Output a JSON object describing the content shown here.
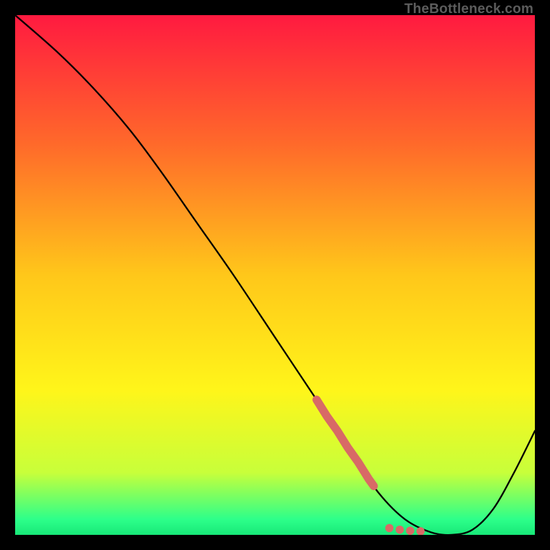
{
  "watermark": "TheBottleneck.com",
  "chart_data": {
    "type": "line",
    "title": "",
    "xlabel": "",
    "ylabel": "",
    "xlim": [
      0,
      100
    ],
    "ylim": [
      0,
      100
    ],
    "grid": false,
    "legend": false,
    "background_gradient": {
      "stops": [
        {
          "pos": 0.0,
          "color": "#ff1a40"
        },
        {
          "pos": 0.25,
          "color": "#ff6a2a"
        },
        {
          "pos": 0.5,
          "color": "#ffc71a"
        },
        {
          "pos": 0.72,
          "color": "#fff51a"
        },
        {
          "pos": 0.88,
          "color": "#c8ff3a"
        },
        {
          "pos": 0.97,
          "color": "#2dff8a"
        },
        {
          "pos": 1.0,
          "color": "#18e878"
        }
      ]
    },
    "series": [
      {
        "name": "curve",
        "x": [
          0,
          8,
          15,
          22,
          28,
          35,
          42,
          50,
          58,
          62,
          66,
          70,
          75,
          80,
          84,
          88,
          92,
          96,
          100
        ],
        "y": [
          100,
          93,
          86,
          78,
          70,
          60,
          50,
          38,
          26,
          20,
          14,
          8,
          3,
          0.5,
          0,
          1,
          5,
          12,
          20
        ]
      }
    ],
    "markers": {
      "name": "highlight",
      "color": "#d86a66",
      "x": [
        58,
        59,
        60,
        61,
        62,
        63,
        64,
        65,
        66,
        67,
        68,
        69,
        72,
        74,
        76,
        78
      ],
      "y": [
        26,
        24.4,
        22.8,
        21.4,
        20,
        18.4,
        16.8,
        15.4,
        14,
        12.4,
        10.8,
        9.4,
        1.3,
        1.0,
        0.8,
        0.7
      ]
    }
  }
}
